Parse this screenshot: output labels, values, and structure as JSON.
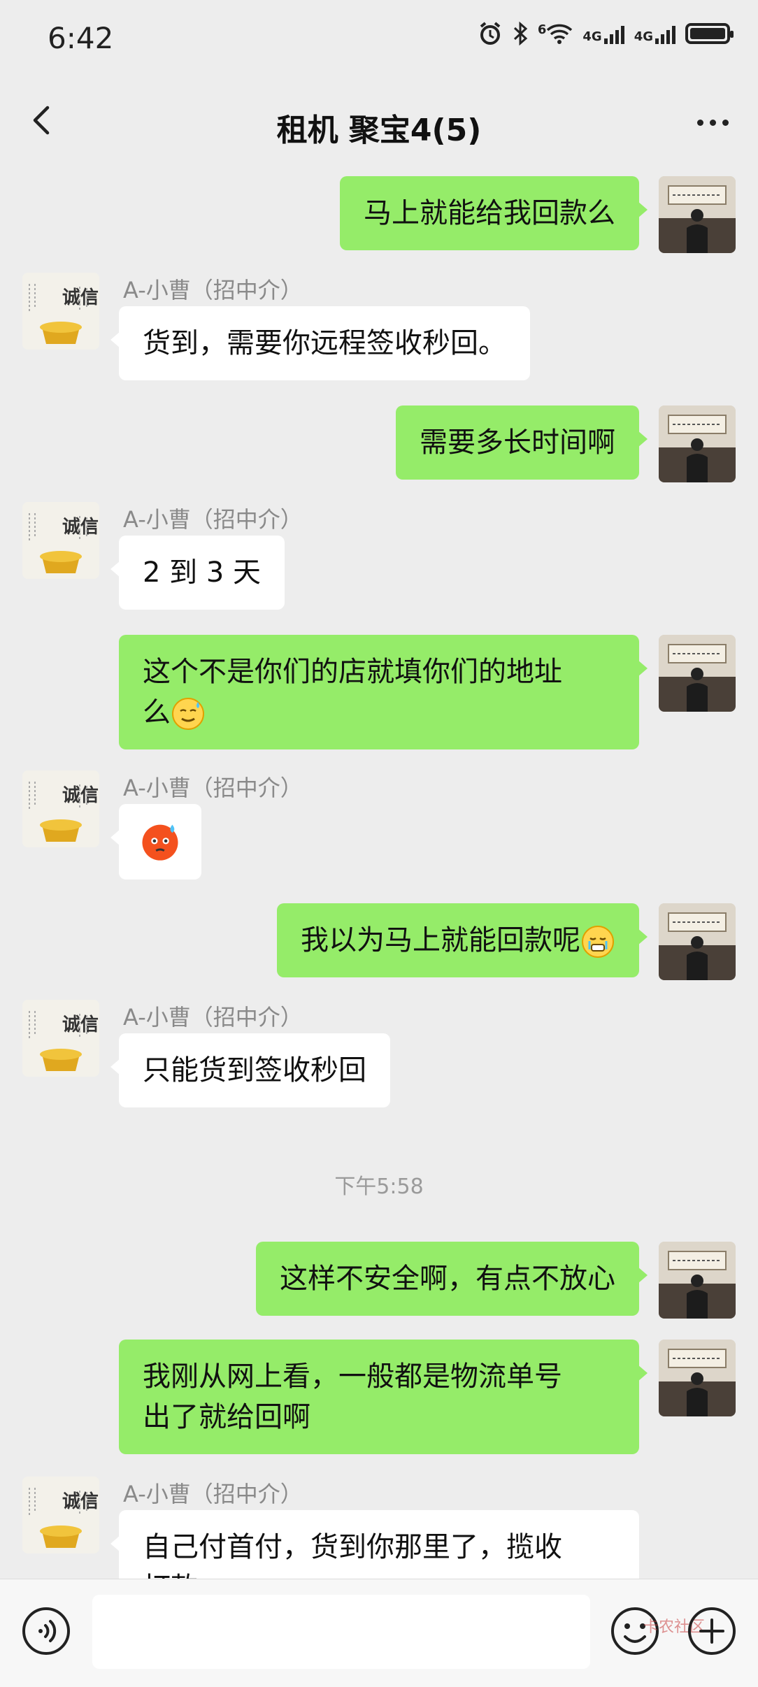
{
  "status_bar": {
    "time": "6:42",
    "wifi_label": "6",
    "network_1": "4G",
    "network_2": "4G"
  },
  "nav": {
    "title": "租机 聚宝4(5)"
  },
  "messages": [
    {
      "side": "right",
      "text": "马上就能给我回款么"
    },
    {
      "side": "left",
      "sender": "A-小曹（招中介）",
      "text": "货到，需要你远程签收秒回。"
    },
    {
      "side": "right",
      "text": "需要多长时间啊"
    },
    {
      "side": "left",
      "sender": "A-小曹（招中介）",
      "text": "2 到 3 天"
    },
    {
      "side": "right",
      "line1": "这个不是你们的店就填你们的地址",
      "line2": "么",
      "emoji": "sweat-smile-emoji"
    },
    {
      "side": "left",
      "sender": "A-小曹（招中介）",
      "emoji": "face-with-sweat-emoji"
    },
    {
      "side": "right",
      "text": "我以为马上就能回款呢",
      "emoji": "tearful-emoji"
    },
    {
      "side": "left",
      "sender": "A-小曹（招中介）",
      "text": "只能货到签收秒回"
    },
    {
      "timestamp": "下午5:58"
    },
    {
      "side": "right",
      "text": "这样不安全啊，有点不放心"
    },
    {
      "side": "right",
      "line1": "我刚从网上看，一般都是物流单号",
      "line2": "出了就给回啊"
    },
    {
      "side": "left",
      "sender": "A-小曹（招中介）",
      "line1": "自己付首付，货到你那里了，揽收",
      "line2": "打款"
    }
  ],
  "input_bar": {
    "placeholder": "",
    "watermark": "卡农社区"
  },
  "avatars": {
    "left_text": "诚信"
  },
  "colors": {
    "background": "#ededed",
    "self_bubble": "#95ec69",
    "other_bubble": "#ffffff",
    "sender_name": "#8a8a8a"
  }
}
